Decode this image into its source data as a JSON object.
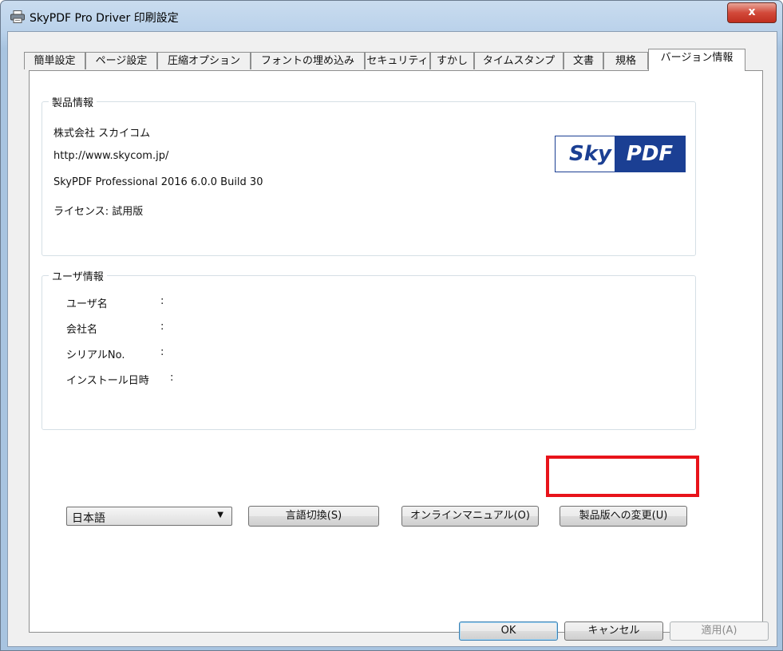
{
  "window": {
    "title": "SkyPDF Pro Driver 印刷設定",
    "close_label": "x"
  },
  "tabs": [
    "簡単設定",
    "ページ設定",
    "圧縮オプション",
    "フォントの埋め込み",
    "セキュリティ",
    "すかし",
    "タイムスタンプ",
    "文書",
    "規格",
    "バージョン情報"
  ],
  "active_tab": "バージョン情報",
  "product_info": {
    "legend": "製品情報",
    "company": "株式会社 スカイコム",
    "url": "http://www.skycom.jp/",
    "version": "SkyPDF Professional 2016 6.0.0 Build 30",
    "license": "ライセンス: 試用版",
    "logo_left": "Sky",
    "logo_right": "PDF"
  },
  "user_info": {
    "legend": "ユーザ情報",
    "rows": [
      {
        "label": "ユーザ名",
        "colon": ":"
      },
      {
        "label": "会社名",
        "colon": ":"
      },
      {
        "label": "シリアルNo.",
        "colon": ":"
      },
      {
        "label": "インストール日時",
        "colon": ":"
      }
    ]
  },
  "controls": {
    "language_select": "日本語",
    "switch_language": "言語切換(S)",
    "online_manual": "オンラインマニュアル(O)",
    "change_to_product": "製品版への変更(U)"
  },
  "footer": {
    "ok": "OK",
    "cancel": "キャンセル",
    "apply": "適用(A)"
  },
  "colors": {
    "highlight": "#e8131a",
    "logo_blue": "#1b3f93"
  }
}
